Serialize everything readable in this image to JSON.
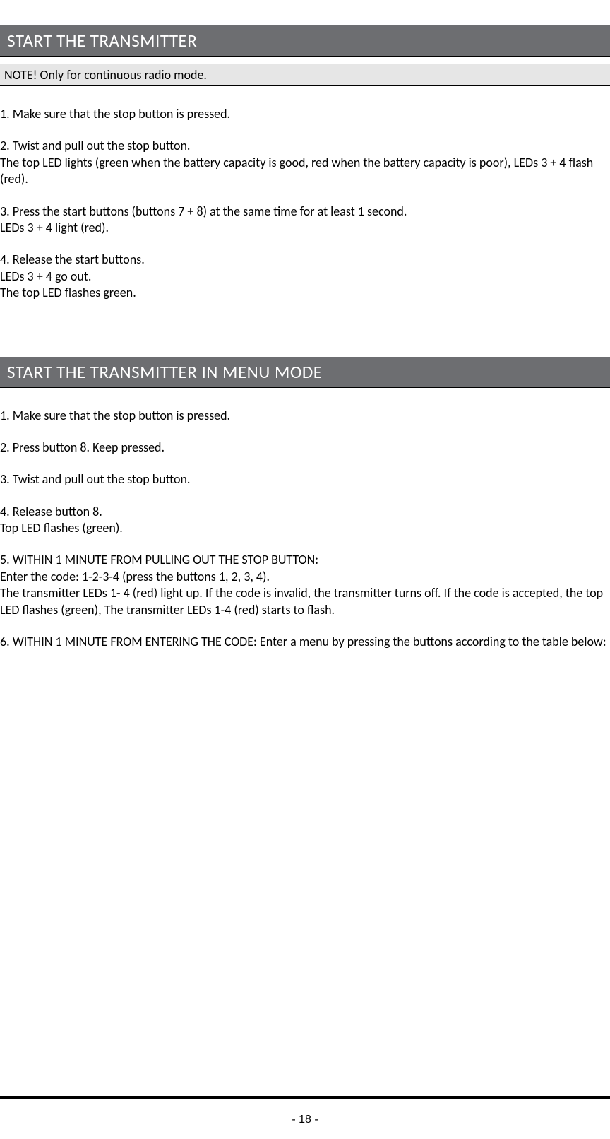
{
  "section1": {
    "title": "START THE TRANSMITTER",
    "note": "NOTE! Only for continuous radio mode.",
    "p1": "1. Make sure that the stop button is pressed.",
    "p2": "2. Twist and pull out the stop button.\nThe top LED lights (green when the battery capacity is good, red when the battery capacity is poor), LEDs 3 + 4 flash (red).",
    "p3": "3. Press the start buttons (buttons 7 + 8) at the same time for at least 1 second.\nLEDs 3 + 4 light (red).",
    "p4": "4. Release the start buttons.\nLEDs 3 + 4 go out.\nThe top LED flashes green."
  },
  "section2": {
    "title": "START THE TRANSMITTER IN MENU MODE",
    "p1": "1. Make sure that the stop button is pressed.",
    "p2": "2. Press button 8. Keep pressed.",
    "p3": "3. Twist and pull out the stop button.",
    "p4": "4. Release button 8.\nTop LED flashes (green).",
    "p5": "5. WITHIN 1 MINUTE FROM PULLING OUT THE STOP BUTTON:\nEnter the code: 1-2-3-4 (press the buttons 1, 2, 3, 4).\nThe transmitter LEDs 1- 4 (red) light up. If the code is invalid, the transmitter turns off. If the code is accepted, the top LED flashes (green), The transmitter LEDs 1-4 (red) starts to flash.",
    "p6": "6. WITHIN 1 MINUTE FROM ENTERING THE CODE: Enter a menu by pressing the buttons according to the table below:"
  },
  "footer": {
    "page": "- 18 -"
  }
}
